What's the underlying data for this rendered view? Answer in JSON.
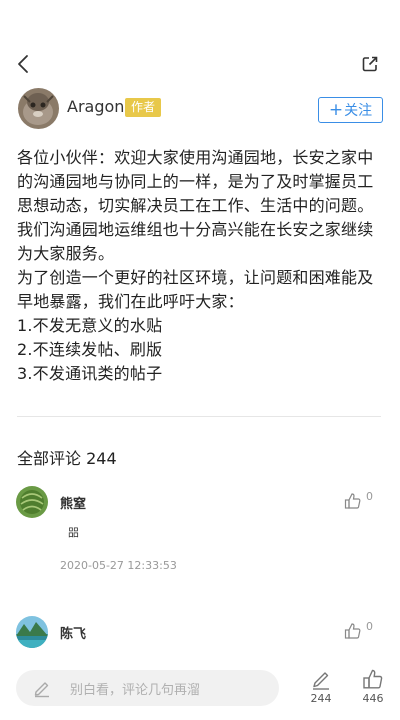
{
  "author": {
    "name": "Aragon",
    "badge": "作者",
    "follow_label": "关注"
  },
  "post": {
    "paragraphs": [
      "各位小伙伴：欢迎大家使用沟通园地，长安之家中的沟通园地与协同上的一样，是为了及时掌握员工思想动态，切实解决员工在工作、生活中的问题。我们沟通园地运维组也十分高兴能在长安之家继续为大家服务。",
      "为了创造一个更好的社区环境，让问题和困难能及早地暴露，我们在此呼吁大家：",
      "1.不发无意义的水贴",
      "2.不连续发帖、刷版",
      "3.不发通讯类的帖子"
    ]
  },
  "comments_header": "全部评论 244",
  "comments": [
    {
      "name": "熊窒",
      "likes": "0",
      "text": "㗊",
      "time": "2020-05-27 12:33:53"
    },
    {
      "name": "陈飞",
      "likes": "0"
    }
  ],
  "bottom": {
    "input_placeholder": "别白看，评论几句再溜",
    "comment_count": "244",
    "like_count": "446"
  },
  "icons": [
    "back-icon",
    "share-icon",
    "thumbs-up-icon",
    "pencil-icon"
  ],
  "colors": {
    "accent": "#3a8ee6",
    "badge": "#e8c84a"
  }
}
